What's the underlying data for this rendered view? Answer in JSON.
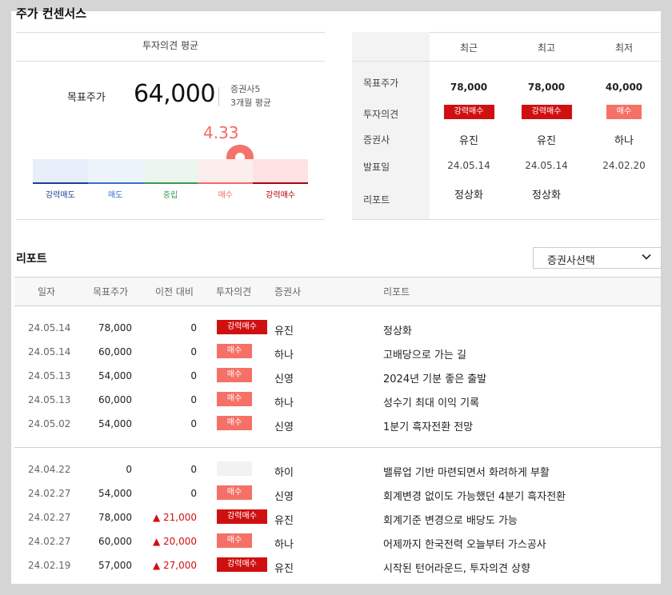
{
  "header": {
    "title": "주가 컨센서스"
  },
  "consensus": {
    "heading": "투자의견 평균",
    "target_label": "목표주가",
    "target_value": "64,000",
    "broker_count": "증권사5",
    "period": "3개월 평균",
    "score": "4.33",
    "score_value": 4.33,
    "scale": [
      {
        "label": "강력매도",
        "color": "#1c3f94",
        "fill": "#e7eef9"
      },
      {
        "label": "매도",
        "color": "#3a6fc8",
        "fill": "#edf3fb"
      },
      {
        "label": "중립",
        "color": "#3a9a4a",
        "fill": "#edf6ee"
      },
      {
        "label": "매수",
        "color": "#f46a63",
        "fill": "#fdeeee"
      },
      {
        "label": "강력매수",
        "color": "#b00010",
        "fill": "#fde2e3"
      }
    ]
  },
  "recent": {
    "columns": [
      "최근",
      "최고",
      "최저"
    ],
    "row_labels": [
      "목표주가",
      "투자의견",
      "증권사",
      "발표일",
      "리포트"
    ],
    "cols": [
      {
        "price": "78,000",
        "opinion": "강력매수",
        "firm": "유진",
        "date": "24.05.14",
        "report": "정상화"
      },
      {
        "price": "78,000",
        "opinion": "강력매수",
        "firm": "유진",
        "date": "24.05.14",
        "report": "정상화"
      },
      {
        "price": "40,000",
        "opinion": "매수",
        "firm": "하나",
        "date": "24.02.20",
        "report": ""
      }
    ]
  },
  "reports": {
    "title": "리포트",
    "select_label": "증권사선택",
    "headers": [
      "일자",
      "목표주가",
      "이전 대비",
      "투자의견",
      "증권사",
      "리포트"
    ],
    "rows": [
      {
        "date": "24.05.14",
        "target": "78,000",
        "diff": "0",
        "up": false,
        "opinion": "강력매수",
        "firm": "유진",
        "title": "정상화"
      },
      {
        "date": "24.05.14",
        "target": "60,000",
        "diff": "0",
        "up": false,
        "opinion": "매수",
        "firm": "하나",
        "title": "고배당으로 가는 길"
      },
      {
        "date": "24.05.13",
        "target": "54,000",
        "diff": "0",
        "up": false,
        "opinion": "매수",
        "firm": "신영",
        "title": "2024년 기분 좋은 출발"
      },
      {
        "date": "24.05.13",
        "target": "60,000",
        "diff": "0",
        "up": false,
        "opinion": "매수",
        "firm": "하나",
        "title": "성수기 최대 이익 기록"
      },
      {
        "date": "24.05.02",
        "target": "54,000",
        "diff": "0",
        "up": false,
        "opinion": "매수",
        "firm": "신영",
        "title": "1분기 흑자전환 전망"
      },
      {
        "date": "24.04.22",
        "target": "0",
        "diff": "0",
        "up": false,
        "opinion": "",
        "firm": "하이",
        "title": "밸류업 기반 마련되면서 화려하게 부활"
      },
      {
        "date": "24.02.27",
        "target": "54,000",
        "diff": "0",
        "up": false,
        "opinion": "매수",
        "firm": "신영",
        "title": "회계변경 없이도 가능했던 4분기 흑자전환"
      },
      {
        "date": "24.02.27",
        "target": "78,000",
        "diff": "▲ 21,000",
        "up": true,
        "opinion": "강력매수",
        "firm": "유진",
        "title": "회계기준 변경으로 배당도 가능"
      },
      {
        "date": "24.02.27",
        "target": "60,000",
        "diff": "▲ 20,000",
        "up": true,
        "opinion": "매수",
        "firm": "하나",
        "title": "어제까지 한국전력 오늘부터 가스공사"
      },
      {
        "date": "24.02.19",
        "target": "57,000",
        "diff": "▲ 27,000",
        "up": true,
        "opinion": "강력매수",
        "firm": "유진",
        "title": "시작된 턴어라운드, 투자의견 상향"
      }
    ]
  }
}
